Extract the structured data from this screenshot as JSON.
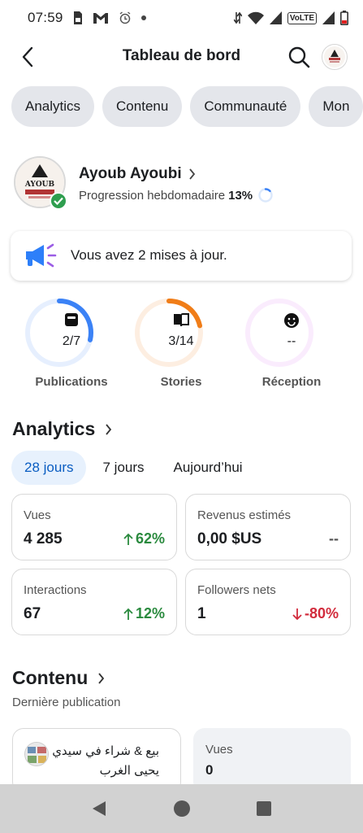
{
  "status_bar": {
    "time": "07:59",
    "volte_label": "VoLTE"
  },
  "header": {
    "title": "Tableau de bord"
  },
  "tabs": [
    {
      "label": "Analytics"
    },
    {
      "label": "Contenu"
    },
    {
      "label": "Communauté"
    },
    {
      "label": "Mon"
    }
  ],
  "profile": {
    "name": "Ayoub Ayoubi",
    "progress_label": "Progression hebdomadaire",
    "progress_pct": "13%",
    "progress_fraction": 0.13
  },
  "update_card": {
    "text": "Vous avez 2 mises à jour."
  },
  "rings": [
    {
      "label": "Publications",
      "value": "2/7",
      "fraction": 0.286,
      "color": "#3b82f6",
      "icon": "document-icon"
    },
    {
      "label": "Stories",
      "value": "3/14",
      "fraction": 0.214,
      "color": "#f07d18",
      "icon": "book-icon"
    },
    {
      "label": "Réception",
      "value": "--",
      "fraction": 0,
      "color": "#d86cf0",
      "icon": "smiley-icon"
    }
  ],
  "analytics": {
    "title": "Analytics",
    "ranges": [
      {
        "label": "28 jours",
        "active": true
      },
      {
        "label": "7 jours",
        "active": false
      },
      {
        "label": "Aujourd’hui",
        "active": false
      }
    ],
    "metrics": [
      {
        "label": "Vues",
        "value": "4 285",
        "change": "62%",
        "trend": "up"
      },
      {
        "label": "Revenus estimés",
        "value": "0,00 $US",
        "change": "--",
        "trend": "neutral"
      },
      {
        "label": "Interactions",
        "value": "67",
        "change": "12%",
        "trend": "up"
      },
      {
        "label": "Followers nets",
        "value": "1",
        "change": "-80%",
        "trend": "down"
      }
    ]
  },
  "content": {
    "title": "Contenu",
    "subtitle": "Dernière publication",
    "post_title": "بيع & شراء في سيدي يحيى الغرب",
    "views_label": "Vues",
    "views_value": "0"
  },
  "colors": {
    "accent": "#0a5dc2",
    "up": "#2a8a3e",
    "down": "#d22b3c",
    "chip_bg": "#e4e6eb"
  }
}
